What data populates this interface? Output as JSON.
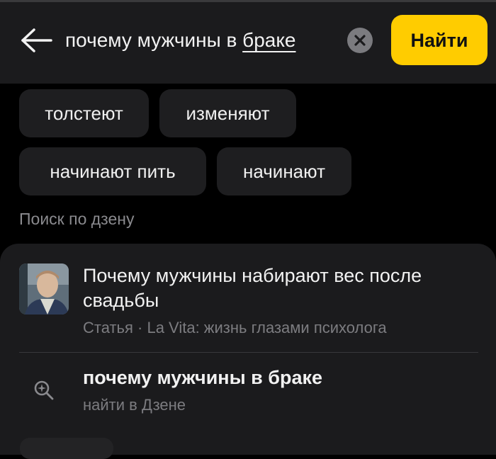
{
  "search": {
    "query_prefix": "почему мужчины в ",
    "query_last_word": "браке",
    "find_label": "Найти"
  },
  "suggestions": [
    {
      "label": "толстеют"
    },
    {
      "label": "изменяют"
    },
    {
      "label": "начинают пить"
    },
    {
      "label": "начинают"
    }
  ],
  "section": {
    "title": "Поиск по дзену"
  },
  "results": {
    "article": {
      "title": "Почему мужчины набирают вес после свадьбы",
      "meta": "Статья · La Vita: жизнь глазами психолога"
    },
    "search_item": {
      "title": "почему мужчины в браке",
      "subtitle": "найти в Дзене"
    }
  },
  "colors": {
    "accent": "#ffcc00",
    "background": "#000000",
    "panel": "#1b1b1d",
    "chip": "#1e1e20",
    "muted_text": "#7c7c80"
  },
  "icons": [
    "back-arrow-icon",
    "clear-icon",
    "search-sparkle-icon"
  ]
}
